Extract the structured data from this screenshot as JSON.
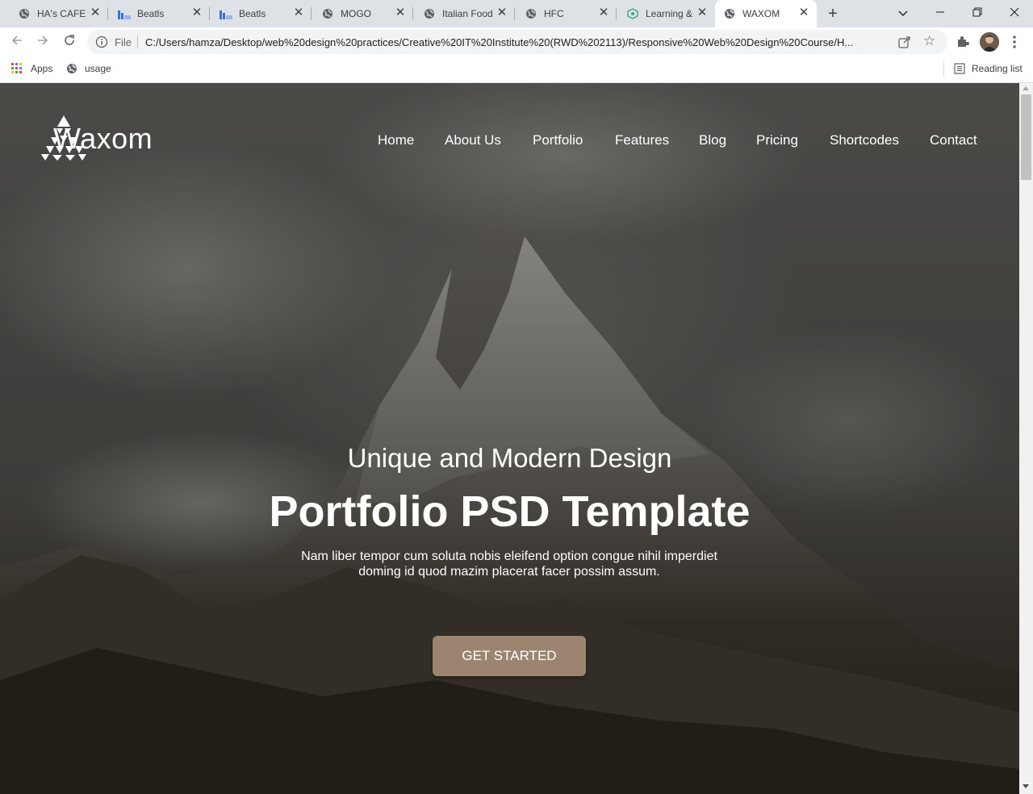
{
  "browser": {
    "tabs": [
      {
        "title": "HA's CAFE",
        "icon": "globe-icon"
      },
      {
        "title": "Beatls",
        "icon": "beatls-icon"
      },
      {
        "title": "Beatls",
        "icon": "beatls-icon"
      },
      {
        "title": "MOGO",
        "icon": "globe-icon"
      },
      {
        "title": "Italian Food",
        "icon": "globe-icon"
      },
      {
        "title": "HFC",
        "icon": "globe-icon"
      },
      {
        "title": "Learning &",
        "icon": "learning-icon"
      },
      {
        "title": "WAXOM",
        "icon": "globe-icon",
        "active": true
      }
    ],
    "omnibox": {
      "scheme_label": "File",
      "url": "C:/Users/hamza/Desktop/web%20design%20practices/Creative%20IT%20Institute%20(RWD%202113)/Responsive%20Web%20Design%20Course/H..."
    },
    "bookmarks": {
      "apps_label": "Apps",
      "usage_label": "usage",
      "reading_list_label": "Reading list"
    }
  },
  "site": {
    "logo_text": "Waxom",
    "nav": [
      "Home",
      "About Us",
      "Portfolio",
      "Features",
      "Blog",
      "Pricing",
      "Shortcodes",
      "Contact"
    ],
    "hero": {
      "subtitle": "Unique and Modern Design",
      "title": "Portfolio PSD Template",
      "description_line1": "Nam liber tempor cum soluta nobis eleifend option congue nihil imperdiet",
      "description_line2": "doming id quod mazim placerat facer possim assum.",
      "cta_label": "GET STARTED"
    },
    "colors": {
      "accent": "#9b8470",
      "overlay": "#4d4b48"
    }
  }
}
